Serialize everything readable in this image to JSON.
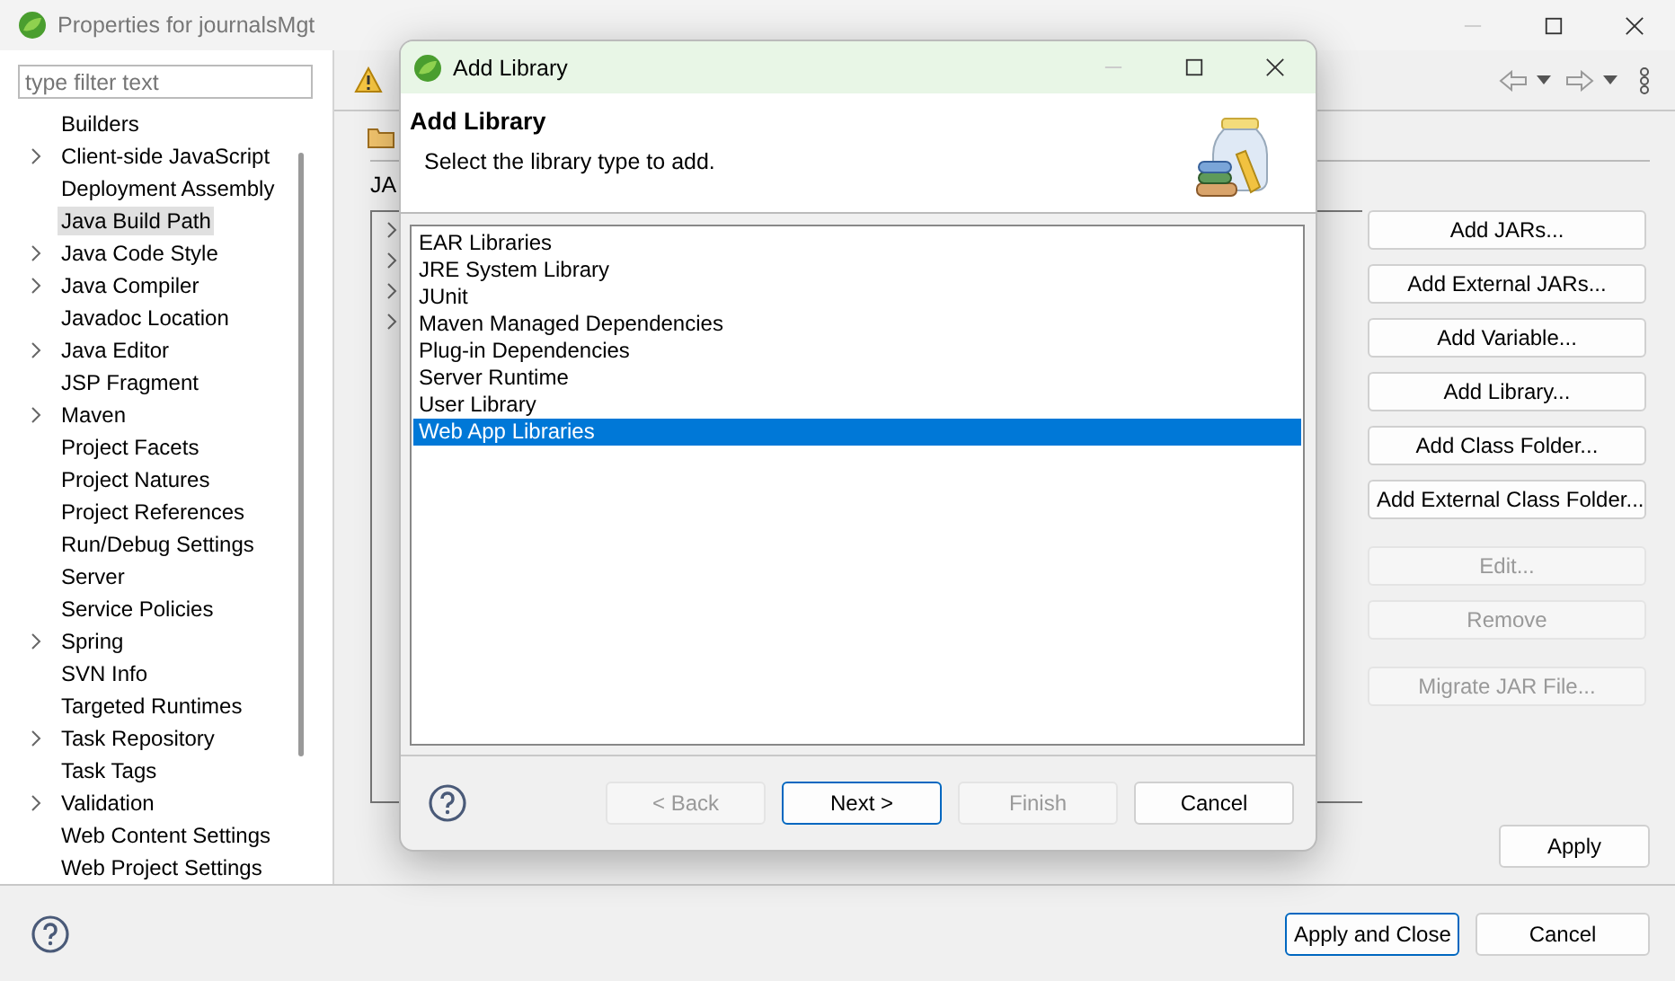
{
  "window": {
    "title": "Properties for journalsMgt"
  },
  "filter": {
    "placeholder": "type filter text"
  },
  "nav_items": [
    {
      "label": "Builders",
      "expandable": false,
      "selected": false
    },
    {
      "label": "Client-side JavaScript",
      "expandable": true,
      "selected": false
    },
    {
      "label": "Deployment Assembly",
      "expandable": false,
      "selected": false
    },
    {
      "label": "Java Build Path",
      "expandable": false,
      "selected": true
    },
    {
      "label": "Java Code Style",
      "expandable": true,
      "selected": false
    },
    {
      "label": "Java Compiler",
      "expandable": true,
      "selected": false
    },
    {
      "label": "Javadoc Location",
      "expandable": false,
      "selected": false
    },
    {
      "label": "Java Editor",
      "expandable": true,
      "selected": false
    },
    {
      "label": "JSP Fragment",
      "expandable": false,
      "selected": false
    },
    {
      "label": "Maven",
      "expandable": true,
      "selected": false
    },
    {
      "label": "Project Facets",
      "expandable": false,
      "selected": false
    },
    {
      "label": "Project Natures",
      "expandable": false,
      "selected": false
    },
    {
      "label": "Project References",
      "expandable": false,
      "selected": false
    },
    {
      "label": "Run/Debug Settings",
      "expandable": false,
      "selected": false
    },
    {
      "label": "Server",
      "expandable": false,
      "selected": false
    },
    {
      "label": "Service Policies",
      "expandable": false,
      "selected": false
    },
    {
      "label": "Spring",
      "expandable": true,
      "selected": false
    },
    {
      "label": "SVN Info",
      "expandable": false,
      "selected": false
    },
    {
      "label": "Targeted Runtimes",
      "expandable": false,
      "selected": false
    },
    {
      "label": "Task Repository",
      "expandable": true,
      "selected": false
    },
    {
      "label": "Task Tags",
      "expandable": false,
      "selected": false
    },
    {
      "label": "Validation",
      "expandable": true,
      "selected": false
    },
    {
      "label": "Web Content Settings",
      "expandable": false,
      "selected": false
    },
    {
      "label": "Web Project Settings",
      "expandable": false,
      "selected": false
    }
  ],
  "page": {
    "label_fragment": "JA",
    "tree_rows": [
      {
        "expanded": false
      },
      {
        "expanded": false
      },
      {
        "expanded": false
      },
      {
        "expanded": false
      }
    ],
    "button_groups": [
      [
        {
          "label": "Add JARs...",
          "disabled": false
        },
        {
          "label": "Add External JARs...",
          "disabled": false
        },
        {
          "label": "Add Variable...",
          "disabled": false
        },
        {
          "label": "Add Library...",
          "disabled": false
        },
        {
          "label": "Add Class Folder...",
          "disabled": false
        },
        {
          "label": "Add External Class Folder...",
          "disabled": false
        }
      ],
      [
        {
          "label": "Edit...",
          "disabled": true
        },
        {
          "label": "Remove",
          "disabled": true
        }
      ],
      [
        {
          "label": "Migrate JAR File...",
          "disabled": true
        }
      ]
    ],
    "apply_button": "Apply"
  },
  "footer_buttons": [
    {
      "label": "Apply and Close",
      "default": true
    },
    {
      "label": "Cancel",
      "default": false
    }
  ],
  "dialog": {
    "title": "Add Library",
    "heading": "Add Library",
    "description": "Select the library type to add.",
    "library_types": [
      {
        "label": "EAR Libraries",
        "selected": false
      },
      {
        "label": "JRE System Library",
        "selected": false
      },
      {
        "label": "JUnit",
        "selected": false
      },
      {
        "label": "Maven Managed Dependencies",
        "selected": false
      },
      {
        "label": "Plug-in Dependencies",
        "selected": false
      },
      {
        "label": "Server Runtime",
        "selected": false
      },
      {
        "label": "User Library",
        "selected": false
      },
      {
        "label": "Web App Libraries",
        "selected": true
      }
    ],
    "buttons": [
      {
        "label": "< Back",
        "disabled": true,
        "default": false
      },
      {
        "label": "Next >",
        "disabled": false,
        "default": true
      },
      {
        "label": "Finish",
        "disabled": true,
        "default": false
      },
      {
        "label": "Cancel",
        "disabled": false,
        "default": false
      }
    ]
  }
}
